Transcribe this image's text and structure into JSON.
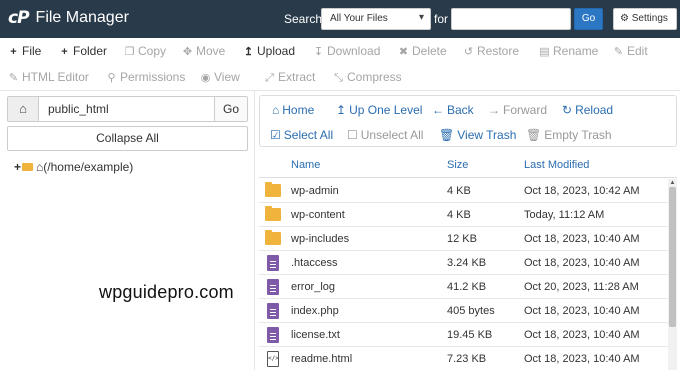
{
  "header": {
    "logo": "cP",
    "title": "File Manager",
    "search_label": "Search",
    "search_scope": "All Your Files",
    "for_label": "for",
    "search_placeholder": "",
    "go_label": "Go",
    "settings_label": "Settings"
  },
  "toolbar": {
    "row1": [
      {
        "label": "File",
        "icon": "plus-icon",
        "enabled": true
      },
      {
        "label": "Folder",
        "icon": "plus-icon",
        "enabled": true
      },
      {
        "label": "Copy",
        "icon": "copy-icon",
        "enabled": false
      },
      {
        "label": "Move",
        "icon": "move-icon",
        "enabled": false
      },
      {
        "label": "Upload",
        "icon": "upload-icon",
        "enabled": true
      },
      {
        "label": "Download",
        "icon": "download-icon",
        "enabled": false
      },
      {
        "label": "Delete",
        "icon": "delete-icon",
        "enabled": false
      },
      {
        "label": "Restore",
        "icon": "restore-icon",
        "enabled": false
      },
      {
        "label": "Rename",
        "icon": "rename-icon",
        "enabled": false
      },
      {
        "label": "Edit",
        "icon": "edit-icon",
        "enabled": false
      }
    ],
    "row2": [
      {
        "label": "HTML Editor",
        "icon": "html-editor-icon",
        "enabled": false
      },
      {
        "label": "Permissions",
        "icon": "key-icon",
        "enabled": false
      },
      {
        "label": "View",
        "icon": "eye-icon",
        "enabled": false
      },
      {
        "label": "Extract",
        "icon": "extract-icon",
        "enabled": false
      },
      {
        "label": "Compress",
        "icon": "compress-icon",
        "enabled": false
      }
    ]
  },
  "sidebar": {
    "path_value": "public_html",
    "go_label": "Go",
    "collapse_label": "Collapse All",
    "tree_root_label": "(/home/example)"
  },
  "watermark": "wpguidepro.com",
  "nav": {
    "home": "Home",
    "up_one_level": "Up One Level",
    "back": "Back",
    "forward": "Forward",
    "reload": "Reload",
    "select_all": "Select All",
    "unselect_all": "Unselect All",
    "view_trash": "View Trash",
    "empty_trash": "Empty Trash"
  },
  "table": {
    "columns": [
      "Name",
      "Size",
      "Last Modified"
    ],
    "rows": [
      {
        "type": "folder",
        "name": "wp-admin",
        "size": "4 KB",
        "modified": "Oct 18, 2023, 10:42 AM"
      },
      {
        "type": "folder",
        "name": "wp-content",
        "size": "4 KB",
        "modified": "Today, 11:12 AM"
      },
      {
        "type": "folder",
        "name": "wp-includes",
        "size": "12 KB",
        "modified": "Oct 18, 2023, 10:40 AM"
      },
      {
        "type": "file",
        "name": ".htaccess",
        "size": "3.24 KB",
        "modified": "Oct 18, 2023, 10:40 AM"
      },
      {
        "type": "file",
        "name": "error_log",
        "size": "41.2 KB",
        "modified": "Oct 20, 2023, 11:28 AM"
      },
      {
        "type": "file",
        "name": "index.php",
        "size": "405 bytes",
        "modified": "Oct 18, 2023, 10:40 AM"
      },
      {
        "type": "file",
        "name": "license.txt",
        "size": "19.45 KB",
        "modified": "Oct 18, 2023, 10:40 AM"
      },
      {
        "type": "html",
        "name": "readme.html",
        "size": "7.23 KB",
        "modified": "Oct 18, 2023, 10:40 AM"
      }
    ]
  },
  "colors": {
    "header_bg": "#293a4a",
    "link": "#2a6db0",
    "go_button": "#2c77c4",
    "folder": "#f0b33c",
    "file": "#7e5aa8"
  }
}
